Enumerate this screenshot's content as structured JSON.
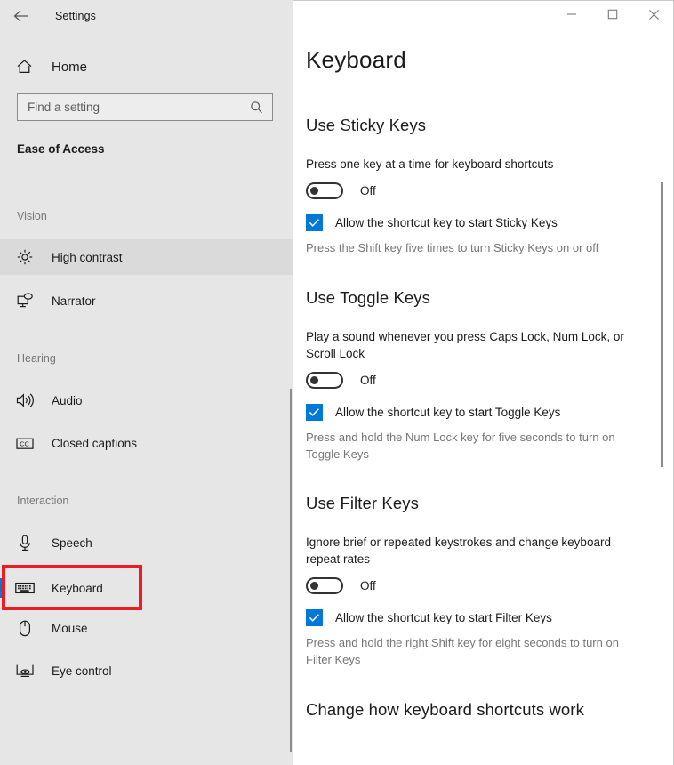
{
  "window": {
    "app_title": "Settings",
    "back_icon": "back-arrow-icon",
    "controls": {
      "minimize": "minimize-icon",
      "maximize": "maximize-icon",
      "close": "close-icon"
    }
  },
  "sidebar": {
    "home_label": "Home",
    "home_icon": "home-icon",
    "search": {
      "placeholder": "Find a setting",
      "value": "",
      "icon": "search-icon"
    },
    "category": "Ease of Access",
    "groups": [
      {
        "label": "Vision",
        "items": [
          {
            "label": "High contrast",
            "icon": "brightness-icon",
            "state": "hovered"
          },
          {
            "label": "Narrator",
            "icon": "narrator-icon",
            "state": "normal"
          }
        ]
      },
      {
        "label": "Hearing",
        "items": [
          {
            "label": "Audio",
            "icon": "speaker-icon",
            "state": "normal"
          },
          {
            "label": "Closed captions",
            "icon": "closed-captions-icon",
            "state": "normal"
          }
        ]
      },
      {
        "label": "Interaction",
        "items": [
          {
            "label": "Speech",
            "icon": "microphone-icon",
            "state": "normal"
          },
          {
            "label": "Keyboard",
            "icon": "keyboard-icon",
            "state": "selected"
          },
          {
            "label": "Mouse",
            "icon": "mouse-icon",
            "state": "normal"
          },
          {
            "label": "Eye control",
            "icon": "eye-control-icon",
            "state": "normal"
          }
        ]
      }
    ]
  },
  "main": {
    "title": "Keyboard",
    "sections": [
      {
        "heading": "Use Sticky Keys",
        "description": "Press one key at a time for keyboard shortcuts",
        "toggle_state": "Off",
        "checkbox_label": "Allow the shortcut key to start Sticky Keys",
        "checkbox_checked": true,
        "hint": "Press the Shift key five times to turn Sticky Keys on or off"
      },
      {
        "heading": "Use Toggle Keys",
        "description": "Play a sound whenever you press Caps Lock, Num Lock, or Scroll Lock",
        "toggle_state": "Off",
        "checkbox_label": "Allow the shortcut key to start Toggle Keys",
        "checkbox_checked": true,
        "hint": "Press and hold the Num Lock key for five seconds to turn on Toggle Keys"
      },
      {
        "heading": "Use Filter Keys",
        "description": "Ignore brief or repeated keystrokes and change keyboard repeat rates",
        "toggle_state": "Off",
        "checkbox_label": "Allow the shortcut key to start Filter Keys",
        "checkbox_checked": true,
        "hint": "Press and hold the right Shift key for eight seconds to turn on Filter Keys"
      }
    ],
    "next_heading": "Change how keyboard shortcuts work"
  },
  "annotation": {
    "target": "Keyboard",
    "color": "#ee1b24"
  },
  "colors": {
    "accent": "#0078d7",
    "sidebar_bg": "#e6e6e6",
    "hover_bg": "#dadada",
    "text": "#1b1b1b",
    "muted_text": "#767676"
  }
}
